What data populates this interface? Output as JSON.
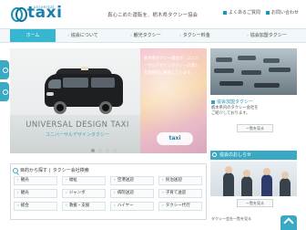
{
  "header": {
    "logo_sub": "universal",
    "logo_text": "taxi",
    "tagline": "真心こめた運転を、栃木県タクシー協会",
    "util_links": [
      "よくあるご質問",
      "お問い合わせ"
    ]
  },
  "nav": {
    "items": [
      "ホーム",
      "協会について",
      "観光タクシー",
      "タクシー料金",
      "協会加盟タクシー"
    ]
  },
  "hero": {
    "title": "UNIVERSAL DESIGN TAXI",
    "subtitle": "ユニバーサルデザインタクシー",
    "caption": "栃木県タクシー協会が、ユニバーサルデザインタクシーの導入を積極的に推進しています。",
    "photo_logo": "taxi"
  },
  "news": {
    "title": "協会加盟タクシー",
    "text_lines": [
      "栃木県内のタクシー会社を",
      "ご紹介しております。"
    ],
    "more": "一覧を見る"
  },
  "recruit": {
    "title": "協会のおしらせ",
    "more": "一覧を見る"
  },
  "search": {
    "heading": "目的から探す",
    "subheading": "タクシー会社検索",
    "items": [
      "観光",
      "福祉",
      "空港送迎",
      "民泊送迎",
      "観光",
      "ジャンボ",
      "病院送迎",
      "子育て送迎",
      "総合",
      "救援・支援",
      "ハイヤー",
      "タクシー代行"
    ]
  },
  "footer": {
    "link": "タクシー会社一覧を見る"
  },
  "colors": {
    "accent": "#3ba9c4",
    "brand": "#1c7fb0"
  }
}
